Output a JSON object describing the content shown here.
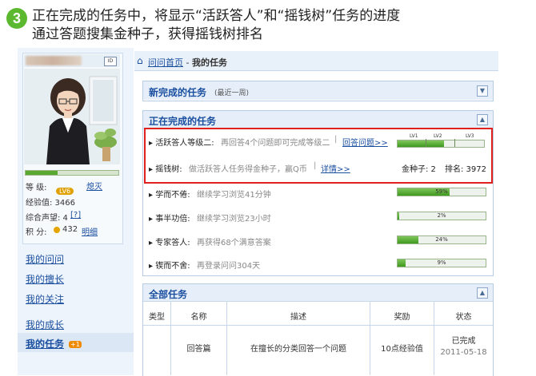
{
  "header": {
    "step_number": "3",
    "line1": "正在完成的任务中，将显示“活跃答人”和“摇钱树”任务的进度",
    "line2": "通过答题搜集金种子，获得摇钱树排名"
  },
  "sidebar": {
    "level_label": "等  级:",
    "level_badge": "LV6",
    "level_name": "熄灭",
    "exp": "经验值: 3466",
    "reputation_label": "综合声望: 4",
    "reputation_help": "[?]",
    "points_label": "积  分:",
    "points_value": "432",
    "points_detail": "明细",
    "nav": [
      "我的问问",
      "我的擅长",
      "我的关注",
      "我的成长",
      "我的任务"
    ],
    "new_badge": "+1"
  },
  "breadcrumb": {
    "home": "问问首页",
    "sep": " - ",
    "current": "我的任务"
  },
  "panels": {
    "new_done": {
      "title": "新完成的任务",
      "subtitle": "(最近一周)"
    },
    "in_progress": {
      "title": "正在完成的任务"
    },
    "all": {
      "title": "全部任务"
    }
  },
  "tasks": [
    {
      "name": "活跃答人等级二:",
      "desc": "再回答4个问题即可完成等级二",
      "link": "回答问题>>",
      "levels": [
        "LV1",
        "LV2",
        "LV3"
      ],
      "progress": 0.55
    },
    {
      "name": "摇钱树:",
      "desc": "做活跃答人任务得金种子，赢Q币",
      "link": "详情>>",
      "gold_label": "金种子: 2",
      "rank_label": "排名: 3972"
    },
    {
      "name": "学而不倦:",
      "desc": "继续学习浏览41分钟",
      "progress_text": "59%",
      "progress": 0.59
    },
    {
      "name": "事半功倍:",
      "desc": "继续学习浏览23小时",
      "progress_text": "2%",
      "progress": 0.02
    },
    {
      "name": "专家答人:",
      "desc": "再获得68个满意答案",
      "progress_text": "24%",
      "progress": 0.24
    },
    {
      "name": "锲而不舍:",
      "desc": "再登录问问304天",
      "progress_text": "9%",
      "progress": 0.09
    }
  ],
  "table": {
    "headers": [
      "类型",
      "名称",
      "描述",
      "奖励",
      "状态"
    ],
    "rows": [
      {
        "name": "回答篇",
        "desc": "在擅长的分类回答一个问题",
        "reward": "10点经验值",
        "status": "已完成",
        "date": "2011-05-18"
      }
    ]
  }
}
